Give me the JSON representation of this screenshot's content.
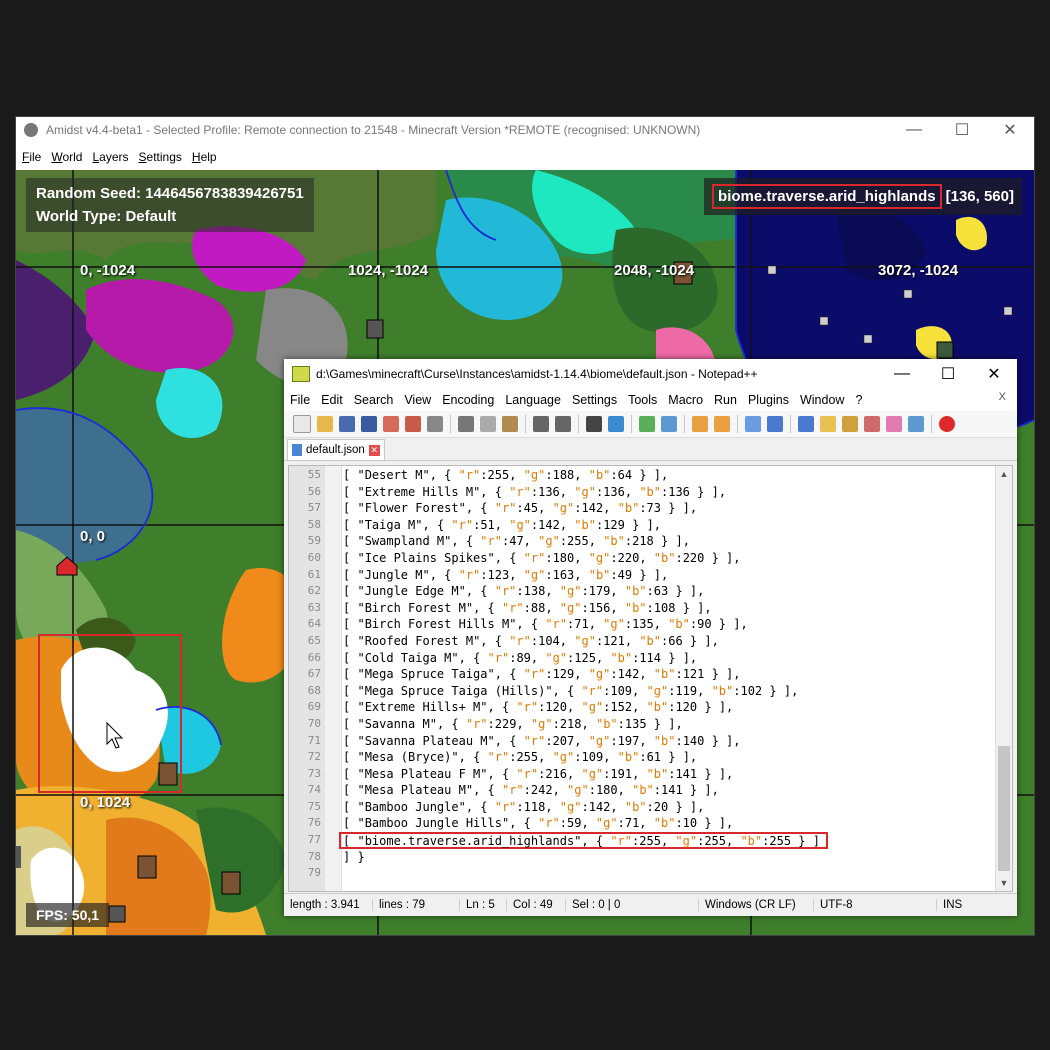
{
  "amidst": {
    "title": "Amidst v4.4-beta1 - Selected Profile: Remote connection to 21548 - Minecraft Version *REMOTE (recognised: UNKNOWN)",
    "menu": [
      "File",
      "World",
      "Layers",
      "Settings",
      "Help"
    ],
    "seed_label": "Random Seed: 1446456783839426751",
    "world_type_label": "World Type: Default",
    "coords": [
      {
        "label": "0, -1024",
        "id": "0-neg1024"
      },
      {
        "label": "1024, -1024",
        "id": "1024-neg1024"
      },
      {
        "label": "2048, -1024",
        "id": "2048-neg1024"
      },
      {
        "label": "3072, -1024",
        "id": "3072-neg1024"
      },
      {
        "label": "0, 0",
        "id": "0-0"
      },
      {
        "label": "0, 1024",
        "id": "0-1024"
      }
    ],
    "biome_name": "biome.traverse.arid_highlands",
    "biome_coords": "[136, 560]",
    "fps": "FPS: 50,1"
  },
  "npp": {
    "title": "d:\\Games\\minecraft\\Curse\\Instances\\amidst-1.14.4\\biome\\default.json - Notepad++",
    "menu": [
      "File",
      "Edit",
      "Search",
      "View",
      "Encoding",
      "Language",
      "Settings",
      "Tools",
      "Macro",
      "Run",
      "Plugins",
      "Window",
      "?"
    ],
    "menu_close": "X",
    "tab_label": "default.json",
    "lines": [
      {
        "n": "55",
        "name": "Desert M",
        "r": "255",
        "g": "188",
        "b": "64"
      },
      {
        "n": "56",
        "name": "Extreme Hills M",
        "r": "136",
        "g": "136",
        "b": "136"
      },
      {
        "n": "57",
        "name": "Flower Forest",
        "r": "45",
        "g": "142",
        "b": "73"
      },
      {
        "n": "58",
        "name": "Taiga M",
        "r": "51",
        "g": "142",
        "b": "129"
      },
      {
        "n": "59",
        "name": "Swampland M",
        "r": "47",
        "g": "255",
        "b": "218"
      },
      {
        "n": "60",
        "name": "Ice Plains Spikes",
        "r": "180",
        "g": "220",
        "b": "220"
      },
      {
        "n": "61",
        "name": "Jungle M",
        "r": "123",
        "g": "163",
        "b": "49"
      },
      {
        "n": "62",
        "name": "Jungle Edge M",
        "r": "138",
        "g": "179",
        "b": "63"
      },
      {
        "n": "63",
        "name": "Birch Forest M",
        "r": "88",
        "g": "156",
        "b": "108"
      },
      {
        "n": "64",
        "name": "Birch Forest Hills M",
        "r": "71",
        "g": "135",
        "b": "90"
      },
      {
        "n": "65",
        "name": "Roofed Forest M",
        "r": "104",
        "g": "121",
        "b": "66"
      },
      {
        "n": "66",
        "name": "Cold Taiga M",
        "r": "89",
        "g": "125",
        "b": "114"
      },
      {
        "n": "67",
        "name": "Mega Spruce Taiga",
        "r": "129",
        "g": "142",
        "b": "121"
      },
      {
        "n": "68",
        "name": "Mega Spruce Taiga (Hills)",
        "r": "109",
        "g": "119",
        "b": "102"
      },
      {
        "n": "69",
        "name": "Extreme Hills+ M",
        "r": "120",
        "g": "152",
        "b": "120"
      },
      {
        "n": "70",
        "name": "Savanna M",
        "r": "229",
        "g": "218",
        "b": "135"
      },
      {
        "n": "71",
        "name": "Savanna Plateau M",
        "r": "207",
        "g": "197",
        "b": "140"
      },
      {
        "n": "72",
        "name": "Mesa (Bryce)",
        "r": "255",
        "g": "109",
        "b": "61"
      },
      {
        "n": "73",
        "name": "Mesa Plateau F M",
        "r": "216",
        "g": "191",
        "b": "141"
      },
      {
        "n": "74",
        "name": "Mesa Plateau M",
        "r": "242",
        "g": "180",
        "b": "141"
      },
      {
        "n": "75",
        "name": "Bamboo Jungle",
        "r": "118",
        "g": "142",
        "b": "20"
      },
      {
        "n": "76",
        "name": "Bamboo Jungle Hills",
        "r": "59",
        "g": "71",
        "b": "10"
      },
      {
        "n": "77",
        "name": "biome.traverse.arid_highlands",
        "r": "255",
        "g": "255",
        "b": "255",
        "last": true
      }
    ],
    "line78": "] }",
    "line78_n": "78",
    "line79_n": "79",
    "status": {
      "length": "length : 3.941",
      "lines": "lines : 79",
      "ln": "Ln : 5",
      "col": "Col : 49",
      "sel": "Sel : 0 | 0",
      "eol": "Windows (CR LF)",
      "enc": "UTF-8",
      "mode": "INS"
    }
  },
  "colors": {
    "highlight": "#d8282e",
    "json_key": "#e07a00"
  }
}
